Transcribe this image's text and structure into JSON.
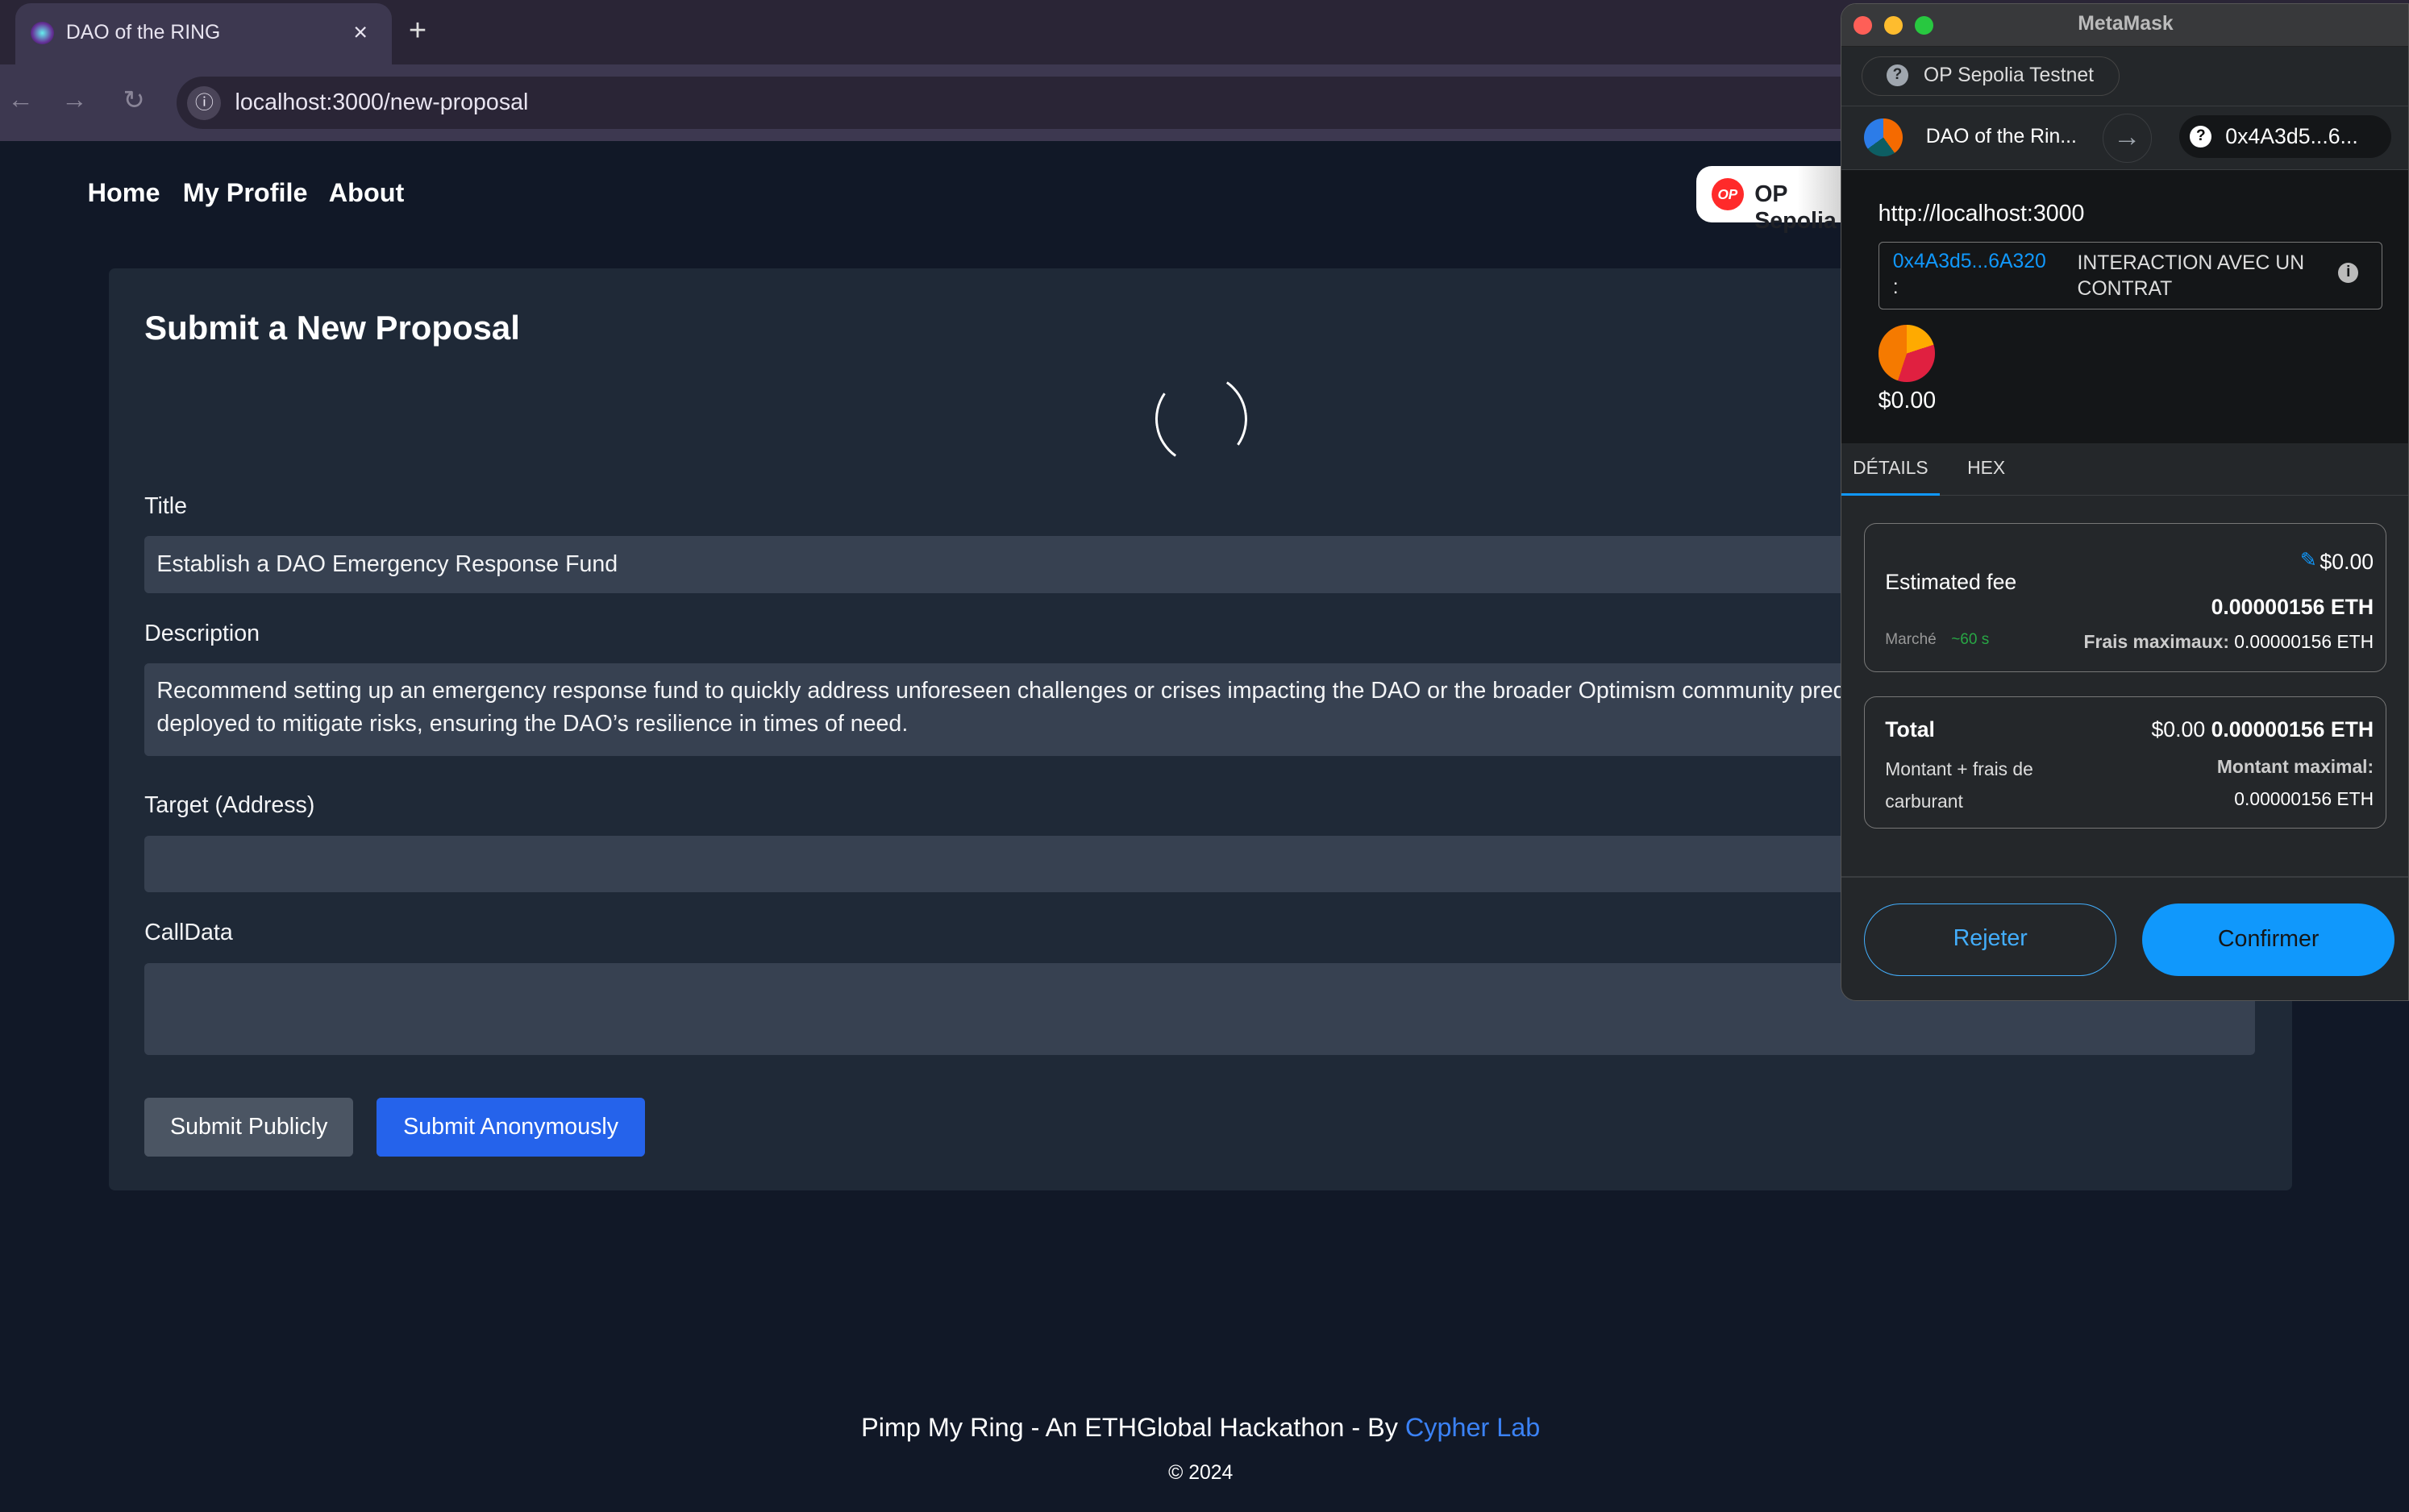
{
  "browser": {
    "tab_title": "DAO of the RING",
    "url": "localhost:3000/new-proposal"
  },
  "nav": {
    "items": [
      "Home",
      "My Profile",
      "About"
    ],
    "network_button": "OP Sepolia"
  },
  "form": {
    "title": "Submit a New Proposal",
    "title_label": "Title",
    "title_value": "Establish a DAO Emergency Response Fund",
    "description_label": "Description",
    "description_value": "Recommend setting up an emergency response fund to quickly address unforeseen challenges or crises impacting the DAO or the broader Optimism community predefined set of rules and can be deployed to mitigate risks, ensuring the DAO’s resilience in times of need.",
    "target_label": "Target (Address)",
    "target_value": "",
    "calldata_label": "CallData",
    "calldata_value": "",
    "submit_public": "Submit Publicly",
    "submit_anon": "Submit Anonymously"
  },
  "footer": {
    "text": "Pimp My Ring - An ETHGlobal Hackathon - By ",
    "link": "Cypher Lab",
    "copyright": "© 2024"
  },
  "metamask": {
    "title": "MetaMask",
    "network": "OP Sepolia Testnet",
    "from": "DAO of the Rin...",
    "to": "0x4A3d5...6...",
    "origin": "http://localhost:3000",
    "contract_addr": "0x4A3d5...6A320",
    "contract_colon": ":",
    "interaction": "INTERACTION AVEC UN CONTRAT",
    "amount": "$0.00",
    "tabs": [
      "DÉTAILS",
      "HEX"
    ],
    "fee_label": "Estimated fee",
    "fee_usd": "$0.00",
    "fee_eth": "0.00000156 ETH",
    "market": "Marché",
    "market_time": "~60 s",
    "max_fee_label": "Frais maximaux:",
    "max_fee": "0.00000156 ETH",
    "total_label": "Total",
    "total_usd": "$0.00",
    "total_eth": "0.00000156 ETH",
    "total_sub": "Montant + frais de carburant",
    "max_amount_label": "Montant maximal:",
    "max_amount": "0.00000156 ETH",
    "reject": "Rejeter",
    "confirm": "Confirmer"
  },
  "colors": {
    "accent": "#2563eb",
    "mm_blue": "#1098fc",
    "market_green": "#28a745"
  }
}
